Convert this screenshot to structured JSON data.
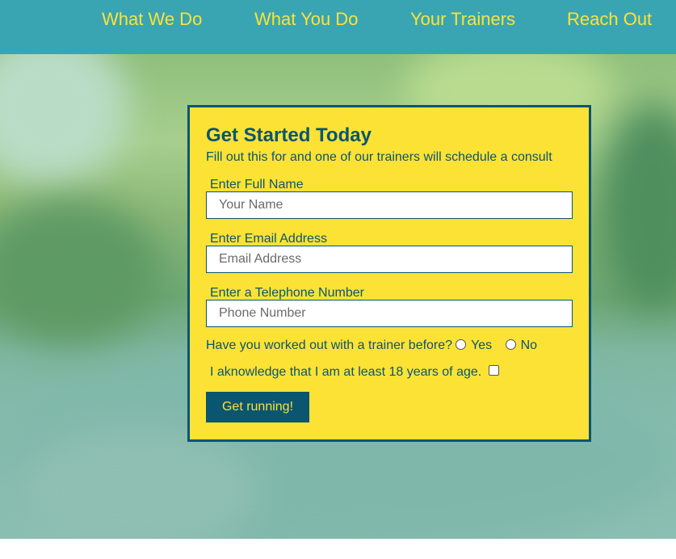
{
  "nav": {
    "items": [
      {
        "label": "What We Do"
      },
      {
        "label": "What You Do"
      },
      {
        "label": "Your Trainers"
      },
      {
        "label": "Reach Out"
      }
    ]
  },
  "form": {
    "title": "Get Started Today",
    "subtitle": "Fill out this for and one of our trainers will schedule a consult",
    "fields": [
      {
        "label": "Enter Full Name",
        "placeholder": "Your Name",
        "value": ""
      },
      {
        "label": "Enter Email Address",
        "placeholder": "Email Address",
        "value": ""
      },
      {
        "label": "Enter a Telephone Number",
        "placeholder": "Phone Number",
        "value": ""
      }
    ],
    "trainer_question": "Have you worked out with a trainer before?",
    "options": [
      {
        "label": "Yes",
        "checked": false
      },
      {
        "label": "No",
        "checked": false
      }
    ],
    "age_acknowledgement": "I aknowledge that I am at least 18 years of age.",
    "age_checked": false,
    "submit_label": "Get running!"
  },
  "colors": {
    "nav_bg": "#3aa5b2",
    "accent_yellow": "#fce235",
    "brand_navy": "#0a5570"
  }
}
